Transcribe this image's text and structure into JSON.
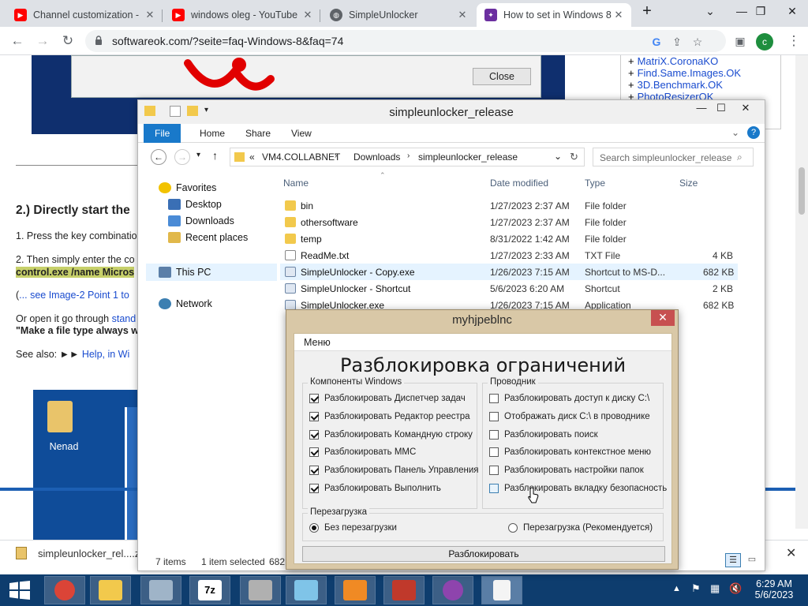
{
  "browser": {
    "tabs": [
      {
        "title": "Channel customization -",
        "favicon": "youtube-icon",
        "color": "#ff0000"
      },
      {
        "title": "windows oleg - YouTube",
        "favicon": "youtube-icon",
        "color": "#ff0000"
      },
      {
        "title": "SimpleUnlocker",
        "favicon": "globe-icon",
        "color": "#5f6368"
      },
      {
        "title": "How to set in Windows 8",
        "favicon": "softwareok-icon",
        "color": "#6b2fa0"
      }
    ],
    "new_tab": "+",
    "url": "softwareok.com/?seite=faq-Windows-8&faq=74",
    "profile_initial": "c",
    "profile_color": "#1e8e3e"
  },
  "webpage": {
    "close_button": "Close",
    "right_links": [
      "MatriX.CoronaKO",
      "Find.Same.Images.OK",
      "3D.Benchmark.OK",
      "PhotoResizerOK"
    ],
    "heading": "2.) Directly start the",
    "step1": "1. Press the key combinatio",
    "step2": "2. Then simply enter the co",
    "command": "control.exe /name Micros",
    "see_image_prefix": "(",
    "see_image_link": "... see Image-2 Point 1 to",
    "or_open_prefix": "Or open it go through",
    "or_open_link": "stand",
    "make_file_type": "\"Make a file type always w",
    "see_also_prefix": "See also: ►►",
    "see_also_link": "Help, in Wi",
    "desktop_icon_label": "Nenad"
  },
  "download_bar": {
    "file": "simpleunlocker_rel....z"
  },
  "explorer": {
    "title": "simpleunlocker_release",
    "ribbon_tabs": [
      "File",
      "Home",
      "Share",
      "View"
    ],
    "path": [
      "«",
      "VM4.COLLABNET",
      "Downloads",
      "simpleunlocker_release"
    ],
    "search_placeholder": "Search simpleunlocker_release",
    "nav": {
      "favorites": "Favorites",
      "desktop": "Desktop",
      "downloads": "Downloads",
      "recent": "Recent places",
      "this_pc": "This PC",
      "network": "Network"
    },
    "columns": [
      "Name",
      "Date modified",
      "Type",
      "Size"
    ],
    "files": [
      {
        "name": "bin",
        "date": "1/27/2023 2:37 AM",
        "type": "File folder",
        "size": "",
        "kind": "folder"
      },
      {
        "name": "othersoftware",
        "date": "1/27/2023 2:37 AM",
        "type": "File folder",
        "size": "",
        "kind": "folder"
      },
      {
        "name": "temp",
        "date": "8/31/2022 1:42 AM",
        "type": "File folder",
        "size": "",
        "kind": "folder"
      },
      {
        "name": "ReadMe.txt",
        "date": "1/27/2023 2:33 AM",
        "type": "TXT File",
        "size": "4 KB",
        "kind": "txt"
      },
      {
        "name": "SimpleUnlocker - Copy.exe",
        "date": "1/26/2023 7:15 AM",
        "type": "Shortcut to MS-D...",
        "size": "682 KB",
        "kind": "exe"
      },
      {
        "name": "SimpleUnlocker - Shortcut",
        "date": "5/6/2023 6:20 AM",
        "type": "Shortcut",
        "size": "2 KB",
        "kind": "shortcut"
      },
      {
        "name": "SimpleUnlocker.exe",
        "date": "1/26/2023 7:15 AM",
        "type": "Application",
        "size": "682 KB",
        "kind": "exe"
      }
    ],
    "status_items": "7 items",
    "status_selected": "1 item selected",
    "status_size": "682"
  },
  "dialog": {
    "title": "myhjpeblnc",
    "menu": "Меню",
    "heading": "Разблокировка ограничений",
    "group_left_title": "Компоненты Windows",
    "left_options": [
      {
        "label": "Разблокировать Диспетчер задач",
        "checked": true
      },
      {
        "label": "Разблокировать Редактор реестра",
        "checked": true
      },
      {
        "label": "Разблокировать Командную строку",
        "checked": true
      },
      {
        "label": "Разблокировать MMC",
        "checked": true
      },
      {
        "label": "Разблокировать Панель Управления",
        "checked": true
      },
      {
        "label": "Разблокировать Выполнить",
        "checked": true
      }
    ],
    "group_right_title": "Проводник",
    "right_options": [
      {
        "label": "Разблокировать доступ к диску C:\\",
        "checked": false
      },
      {
        "label": "Отображать диск C:\\ в проводнике",
        "checked": false
      },
      {
        "label": "Разблокировать поиск",
        "checked": false
      },
      {
        "label": "Разблокировать контекстное меню",
        "checked": false
      },
      {
        "label": "Разблокировать настройки папок",
        "checked": false
      },
      {
        "label": "Разблокировать вкладку безопасность",
        "checked": false
      }
    ],
    "reboot_title": "Перезагрузка",
    "reboot_none": "Без перезагрузки",
    "reboot_recommended": "Перезагрузка (Рекомендуется)",
    "unlock_button": "Разблокировать"
  },
  "taskbar": {
    "time": "6:29 AM",
    "date": "5/6/2023",
    "apps": [
      {
        "name": "chrome-icon",
        "color": "#db4437"
      },
      {
        "name": "file-explorer-icon",
        "color": "#f2c94c"
      },
      {
        "name": "task-manager-icon",
        "color": "#9fb4c8"
      },
      {
        "name": "7zip-icon",
        "color": "#ffffff"
      },
      {
        "name": "tool-icon",
        "color": "#b0b0b0"
      },
      {
        "name": "notepad-icon",
        "color": "#7fc4e8"
      },
      {
        "name": "media-player-icon",
        "color": "#f08a24"
      },
      {
        "name": "video-editor-icon",
        "color": "#c0392b"
      },
      {
        "name": "paint-icon",
        "color": "#8e44ad"
      },
      {
        "name": "blank-document-icon",
        "color": "#f4f4f4"
      }
    ]
  }
}
